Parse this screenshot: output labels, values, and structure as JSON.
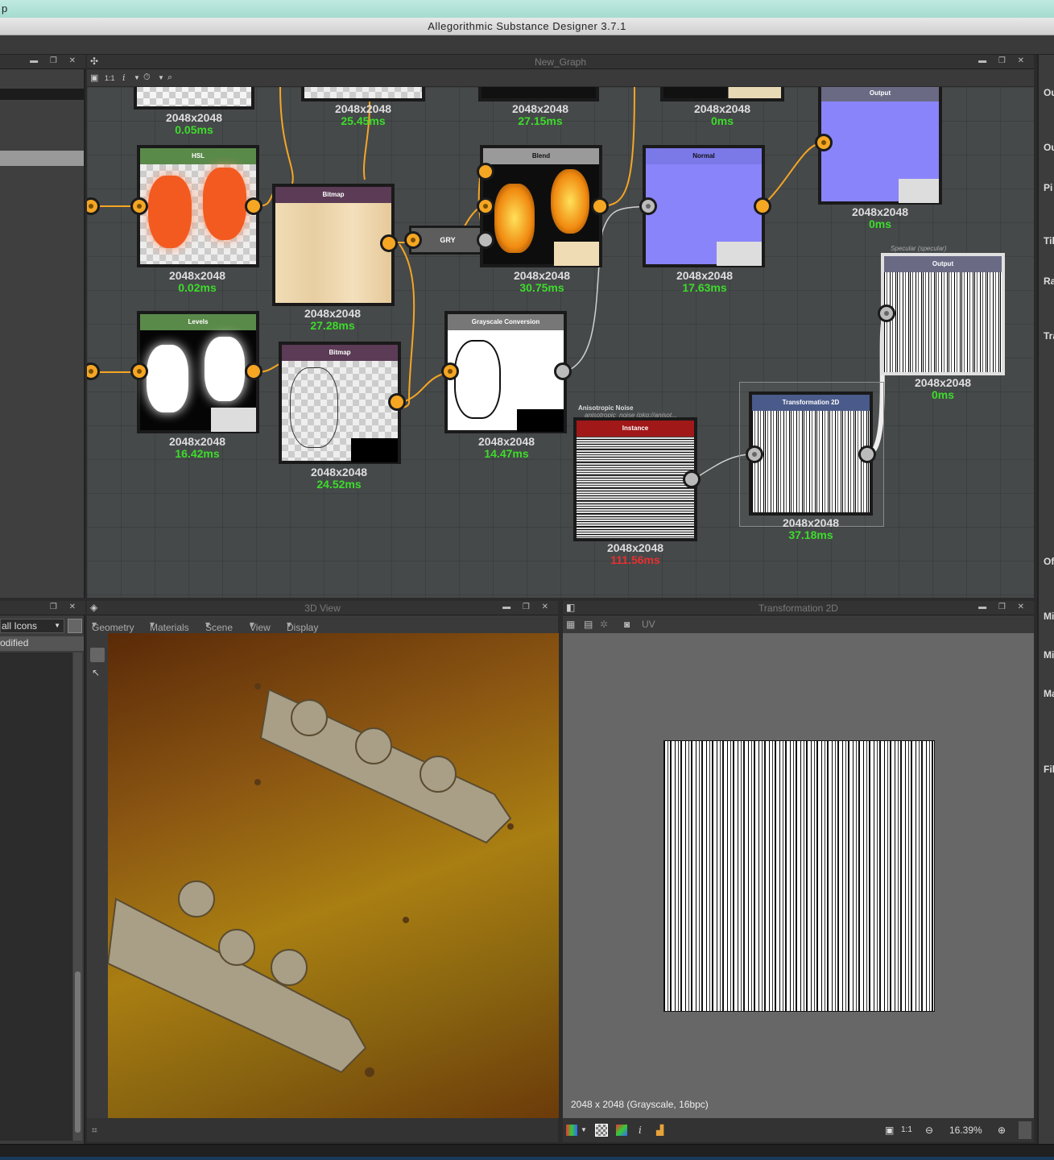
{
  "app": {
    "top_strip": "p",
    "title": "Allegorithmic Substance Designer 3.7.1"
  },
  "graph": {
    "title": "New_Graph",
    "toolbar": {
      "zoom_label": "1:1",
      "info_label": "i"
    },
    "top_row": [
      {
        "size": "2048x2048",
        "time": "0.05ms"
      },
      {
        "size": "2048x2048",
        "time": "25.45ms"
      },
      {
        "size": "2048x2048",
        "time": "27.15ms"
      },
      {
        "size": "2048x2048",
        "time": "0ms"
      }
    ],
    "nodes": {
      "hsl": {
        "label": "HSL",
        "size": "2048x2048",
        "time": "0.02ms",
        "header_color": "#5a8a4a"
      },
      "bitmap1": {
        "label": "Bitmap",
        "size": "2048x2048",
        "time": "27.28ms",
        "header_color": "#5b3b55"
      },
      "gry": {
        "label": "GRY"
      },
      "blend": {
        "label": "Blend",
        "size": "2048x2048",
        "time": "30.75ms",
        "header_color": "#9a9a9a"
      },
      "normal": {
        "label": "Normal",
        "size": "2048x2048",
        "time": "17.63ms",
        "header_color": "#7b78e8"
      },
      "output1": {
        "label": "Output",
        "size": "2048x2048",
        "time": "0ms",
        "header_color": "#6a6a85"
      },
      "specular_note": "Specular (specular)",
      "output2": {
        "label": "Output",
        "size": "2048x2048",
        "time": "0ms",
        "header_color": "#6a6a85"
      },
      "levels": {
        "label": "Levels",
        "size": "2048x2048",
        "time": "16.42ms",
        "header_color": "#5a8a4a"
      },
      "bitmap2": {
        "label": "Bitmap",
        "size": "2048x2048",
        "time": "24.52ms",
        "header_color": "#5b3b55"
      },
      "grayscale": {
        "label": "Grayscale Conversion",
        "size": "2048x2048",
        "time": "14.47ms",
        "header_color": "#777777"
      },
      "aniso_note_title": "Anisotropic Noise",
      "aniso_note_sub": "anisotropic_noise (pkg://anisot...",
      "instance": {
        "label": "Instance",
        "size": "2048x2048",
        "time": "111.56ms",
        "header_color": "#a01818"
      },
      "transform": {
        "label": "Transformation 2D",
        "size": "2048x2048",
        "time": "37.18ms",
        "header_color": "#4a5a8a"
      }
    }
  },
  "left_panel": {
    "combo_value": "all Icons",
    "filter_label": "odified"
  },
  "view3d": {
    "title": "3D View",
    "menu": [
      "Geometry",
      "Materials",
      "Scene",
      "View",
      "Display"
    ]
  },
  "view2d": {
    "title": "Transformation 2D",
    "menu_uv": "UV",
    "info": "2048 x 2048 (Grayscale, 16bpc)",
    "zoom_ratio": "1:1",
    "info_icon_label": "i",
    "zoom": "16.39%"
  },
  "right_panel": {
    "labels": [
      "Ou",
      "Ou",
      "Pi",
      "Til",
      "Ra",
      "Tra",
      "Of",
      "Mi",
      "Mi",
      "Ma",
      "Fil"
    ]
  },
  "colors": {
    "port": "#f5a623",
    "time_ok": "#3ddc2b",
    "time_slow": "#e83030"
  }
}
